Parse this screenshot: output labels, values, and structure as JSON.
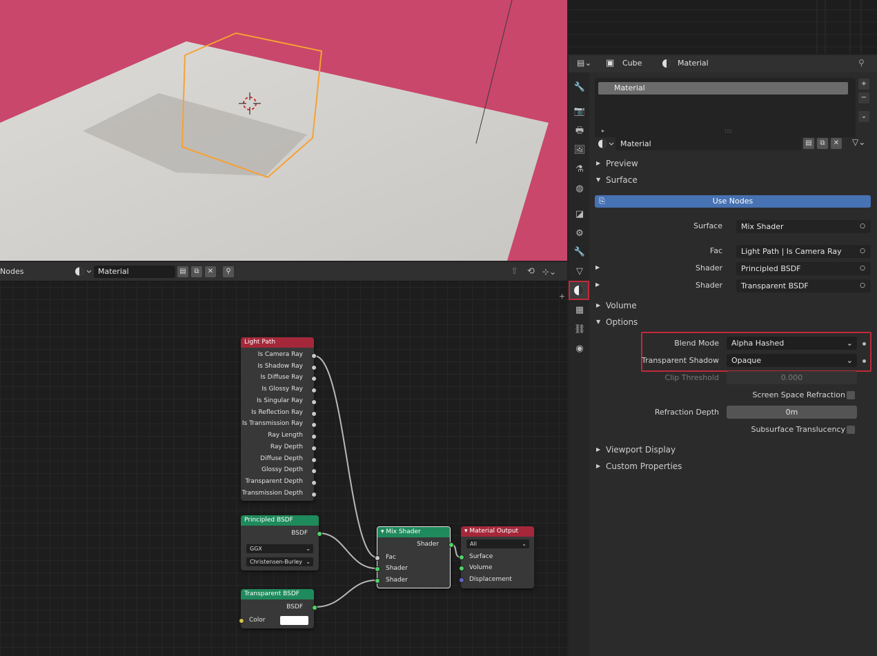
{
  "node_editor": {
    "header": {
      "editor_label": "Nodes",
      "material_name": "Material"
    },
    "nodes": {
      "light_path": {
        "title": "Light Path",
        "outputs": [
          "Is Camera Ray",
          "Is Shadow Ray",
          "Is Diffuse Ray",
          "Is Glossy Ray",
          "Is Singular Ray",
          "Is Reflection Ray",
          "Is Transmission Ray",
          "Ray Length",
          "Ray Depth",
          "Diffuse Depth",
          "Glossy Depth",
          "Transparent Depth",
          "Transmission Depth"
        ]
      },
      "principled": {
        "title": "Principled BSDF",
        "output": "BSDF",
        "distribution": "GGX",
        "subsurface_method": "Christensen-Burley"
      },
      "transparent": {
        "title": "Transparent BSDF",
        "output": "BSDF",
        "color_label": "Color",
        "color_value": "#ffffff"
      },
      "mix_shader": {
        "title": "Mix Shader",
        "output": "Shader",
        "inputs": [
          "Fac",
          "Shader",
          "Shader"
        ]
      },
      "material_output": {
        "title": "Material Output",
        "target": "All",
        "inputs": [
          "Surface",
          "Volume",
          "Displacement"
        ]
      }
    }
  },
  "properties": {
    "header": {
      "object_name": "Cube",
      "material_name": "Material"
    },
    "slot_list": {
      "selected_slot": "Material",
      "expand_hint": "::::"
    },
    "material_selector": {
      "name": "Material"
    },
    "sections": {
      "preview": "Preview",
      "surface": "Surface",
      "volume": "Volume",
      "options": "Options",
      "viewport_display": "Viewport Display",
      "custom_properties": "Custom Properties"
    },
    "use_nodes_label": "Use Nodes",
    "surface": {
      "surface_label": "Surface",
      "surface_value": "Mix Shader",
      "fac_label": "Fac",
      "fac_value": "Light Path | Is Camera Ray",
      "shader1_label": "Shader",
      "shader1_value": "Principled BSDF",
      "shader2_label": "Shader",
      "shader2_value": "Transparent BSDF"
    },
    "options": {
      "blend_mode_label": "Blend Mode",
      "blend_mode_value": "Alpha Hashed",
      "transparent_shadow_label": "Transparent Shadow",
      "transparent_shadow_value": "Opaque",
      "clip_threshold_label": "Clip Threshold",
      "clip_threshold_value": "0.000",
      "ssr_label": "Screen Space Refraction",
      "refraction_depth_label": "Refraction Depth",
      "refraction_depth_value": "0m",
      "subsurface_translucency_label": "Subsurface Translucency"
    }
  },
  "colors": {
    "viewport_background": "#c9476a",
    "highlight_box": "#c12a39",
    "selection_outline": "#f5a135",
    "use_nodes_button": "#4772b3"
  }
}
